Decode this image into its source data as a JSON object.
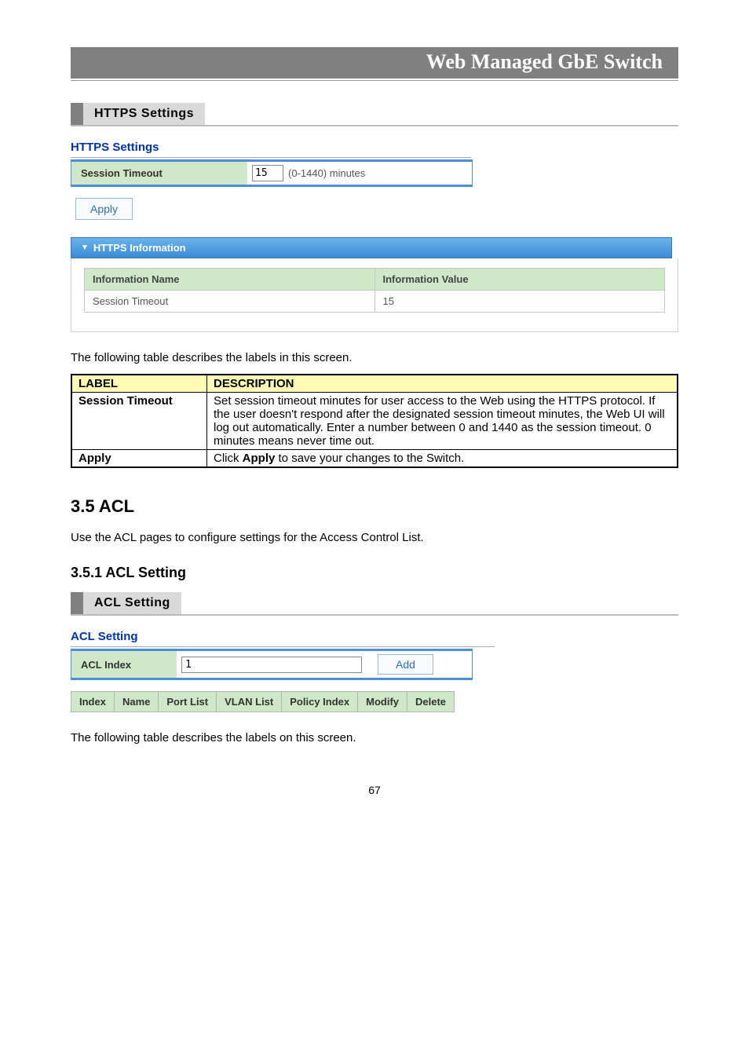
{
  "header_banner": "Web Managed GbE Switch",
  "https_settings": {
    "tab_label": "HTTPS Settings",
    "section_title": "HTTPS Settings",
    "session_timeout_label": "Session Timeout",
    "session_timeout_value": "15",
    "session_timeout_units": "(0-1440) minutes",
    "apply_button": "Apply",
    "info_panel_title": "HTTPS Information",
    "info_headers": {
      "name": "Information Name",
      "value": "Information Value"
    },
    "info_row": {
      "name": "Session Timeout",
      "value": "15"
    }
  },
  "desc_intro": "The following table describes the labels in this screen.",
  "desc_table": {
    "headers": {
      "label": "LABEL",
      "description": "DESCRIPTION"
    },
    "rows": [
      {
        "label": "Session Timeout",
        "description_plain": "Set session timeout minutes for user access to the Web using the HTTPS protocol. If the user doesn't respond after the designated session timeout minutes, the Web UI will log out automatically. Enter a number between 0 and 1440 as the session timeout. 0 minutes means never time out."
      },
      {
        "label": "Apply",
        "description_prefix": "Click ",
        "description_bold": "Apply",
        "description_suffix": " to save your changes to the Switch."
      }
    ]
  },
  "acl": {
    "heading": "3.5 ACL",
    "intro": "Use the ACL pages to configure settings for the Access Control List.",
    "sub_heading": "3.5.1 ACL Setting",
    "tab_label": "ACL Setting",
    "section_title": "ACL Setting",
    "acl_index_label": "ACL Index",
    "acl_index_value": "1",
    "add_button": "Add",
    "columns": [
      "Index",
      "Name",
      "Port List",
      "VLAN List",
      "Policy Index",
      "Modify",
      "Delete"
    ],
    "desc_intro2": "The following table describes the labels on this screen."
  },
  "page_number": "67"
}
